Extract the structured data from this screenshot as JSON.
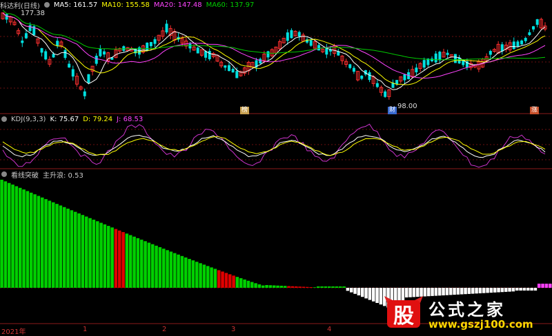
{
  "main_header": {
    "title": "科达利(日线)",
    "ma5": "MA5: 161.57",
    "ma10": "MA10: 155.58",
    "ma20": "MA20: 147.48",
    "ma60": "MA60: 137.97",
    "high_label": "177.38",
    "low_label": "98.00",
    "colors": {
      "ma5": "#ffffff",
      "ma10": "#ffff00",
      "ma20": "#ff44ff",
      "ma60": "#00cc00",
      "title": "#cccccc"
    }
  },
  "markers": [
    {
      "text": "榜"
    },
    {
      "text": "财"
    },
    {
      "text": "涨"
    }
  ],
  "kdj_header": {
    "title": "KDJ(9,3,3)",
    "k": "K: 75.67",
    "d": "D: 79.24",
    "j": "J: 68.53"
  },
  "ind_header": {
    "title": "看线突破",
    "value": "主升浪: 0.53"
  },
  "x_labels": [
    "2021年",
    "1",
    "2",
    "3",
    "4"
  ],
  "logo": {
    "glyph": "股",
    "name": "公式之家",
    "url": "www.gszj100.com"
  }
}
